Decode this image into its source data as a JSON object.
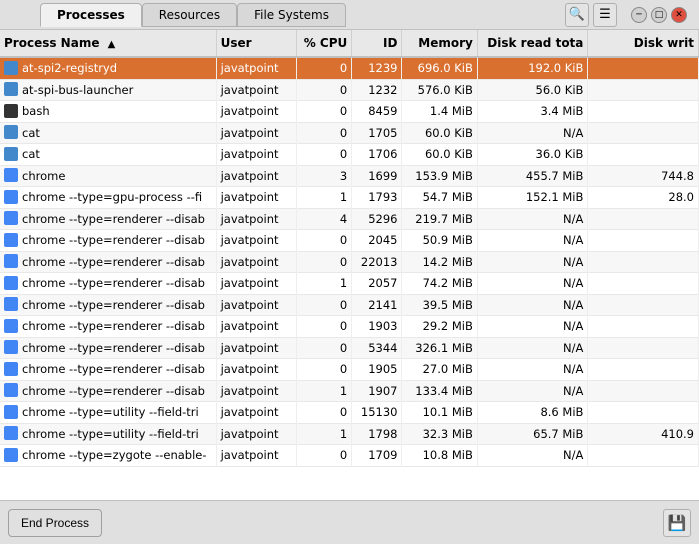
{
  "titlebar": {
    "tabs": [
      {
        "label": "Processes",
        "active": true
      },
      {
        "label": "Resources",
        "active": false
      },
      {
        "label": "File Systems",
        "active": false
      }
    ],
    "search_icon": "🔍",
    "menu_icon": "☰"
  },
  "table": {
    "columns": [
      {
        "label": "Process Name",
        "sort_arrow": "▲"
      },
      {
        "label": "User"
      },
      {
        "label": "% CPU"
      },
      {
        "label": "ID"
      },
      {
        "label": "Memory"
      },
      {
        "label": "Disk read tota"
      },
      {
        "label": "Disk writ"
      }
    ],
    "rows": [
      {
        "name": "at-spi2-registryd",
        "user": "javatpoint",
        "cpu": "0",
        "id": "1239",
        "memory": "696.0 KiB",
        "disk_read": "192.0 KiB",
        "disk_write": "",
        "selected": true,
        "icon": "blue"
      },
      {
        "name": "at-spi-bus-launcher",
        "user": "javatpoint",
        "cpu": "0",
        "id": "1232",
        "memory": "576.0 KiB",
        "disk_read": "56.0 KiB",
        "disk_write": "",
        "selected": false,
        "icon": "blue"
      },
      {
        "name": "bash",
        "user": "javatpoint",
        "cpu": "0",
        "id": "8459",
        "memory": "1.4 MiB",
        "disk_read": "3.4 MiB",
        "disk_write": "",
        "selected": false,
        "icon": "bash"
      },
      {
        "name": "cat",
        "user": "javatpoint",
        "cpu": "0",
        "id": "1705",
        "memory": "60.0 KiB",
        "disk_read": "N/A",
        "disk_write": "",
        "selected": false,
        "icon": "blue"
      },
      {
        "name": "cat",
        "user": "javatpoint",
        "cpu": "0",
        "id": "1706",
        "memory": "60.0 KiB",
        "disk_read": "36.0 KiB",
        "disk_write": "",
        "selected": false,
        "icon": "blue"
      },
      {
        "name": "chrome",
        "user": "javatpoint",
        "cpu": "3",
        "id": "1699",
        "memory": "153.9 MiB",
        "disk_read": "455.7 MiB",
        "disk_write": "744.8",
        "selected": false,
        "icon": "chrome"
      },
      {
        "name": "chrome --type=gpu-process --fi",
        "user": "javatpoint",
        "cpu": "1",
        "id": "1793",
        "memory": "54.7 MiB",
        "disk_read": "152.1 MiB",
        "disk_write": "28.0",
        "selected": false,
        "icon": "chrome"
      },
      {
        "name": "chrome --type=renderer --disab",
        "user": "javatpoint",
        "cpu": "4",
        "id": "5296",
        "memory": "219.7 MiB",
        "disk_read": "N/A",
        "disk_write": "",
        "selected": false,
        "icon": "chrome"
      },
      {
        "name": "chrome --type=renderer --disab",
        "user": "javatpoint",
        "cpu": "0",
        "id": "2045",
        "memory": "50.9 MiB",
        "disk_read": "N/A",
        "disk_write": "",
        "selected": false,
        "icon": "chrome"
      },
      {
        "name": "chrome --type=renderer --disab",
        "user": "javatpoint",
        "cpu": "0",
        "id": "22013",
        "memory": "14.2 MiB",
        "disk_read": "N/A",
        "disk_write": "",
        "selected": false,
        "icon": "chrome"
      },
      {
        "name": "chrome --type=renderer --disab",
        "user": "javatpoint",
        "cpu": "1",
        "id": "2057",
        "memory": "74.2 MiB",
        "disk_read": "N/A",
        "disk_write": "",
        "selected": false,
        "icon": "chrome"
      },
      {
        "name": "chrome --type=renderer --disab",
        "user": "javatpoint",
        "cpu": "0",
        "id": "2141",
        "memory": "39.5 MiB",
        "disk_read": "N/A",
        "disk_write": "",
        "selected": false,
        "icon": "chrome"
      },
      {
        "name": "chrome --type=renderer --disab",
        "user": "javatpoint",
        "cpu": "0",
        "id": "1903",
        "memory": "29.2 MiB",
        "disk_read": "N/A",
        "disk_write": "",
        "selected": false,
        "icon": "chrome"
      },
      {
        "name": "chrome --type=renderer --disab",
        "user": "javatpoint",
        "cpu": "0",
        "id": "5344",
        "memory": "326.1 MiB",
        "disk_read": "N/A",
        "disk_write": "",
        "selected": false,
        "icon": "chrome"
      },
      {
        "name": "chrome --type=renderer --disab",
        "user": "javatpoint",
        "cpu": "0",
        "id": "1905",
        "memory": "27.0 MiB",
        "disk_read": "N/A",
        "disk_write": "",
        "selected": false,
        "icon": "chrome"
      },
      {
        "name": "chrome --type=renderer --disab",
        "user": "javatpoint",
        "cpu": "1",
        "id": "1907",
        "memory": "133.4 MiB",
        "disk_read": "N/A",
        "disk_write": "",
        "selected": false,
        "icon": "chrome"
      },
      {
        "name": "chrome --type=utility --field-tri",
        "user": "javatpoint",
        "cpu": "0",
        "id": "15130",
        "memory": "10.1 MiB",
        "disk_read": "8.6 MiB",
        "disk_write": "",
        "selected": false,
        "icon": "chrome"
      },
      {
        "name": "chrome --type=utility --field-tri",
        "user": "javatpoint",
        "cpu": "1",
        "id": "1798",
        "memory": "32.3 MiB",
        "disk_read": "65.7 MiB",
        "disk_write": "410.9",
        "selected": false,
        "icon": "chrome"
      },
      {
        "name": "chrome --type=zygote --enable-",
        "user": "javatpoint",
        "cpu": "0",
        "id": "1709",
        "memory": "10.8 MiB",
        "disk_read": "N/A",
        "disk_write": "",
        "selected": false,
        "icon": "chrome"
      }
    ]
  },
  "bottom": {
    "end_process_label": "End Process",
    "save_icon": "💾"
  }
}
